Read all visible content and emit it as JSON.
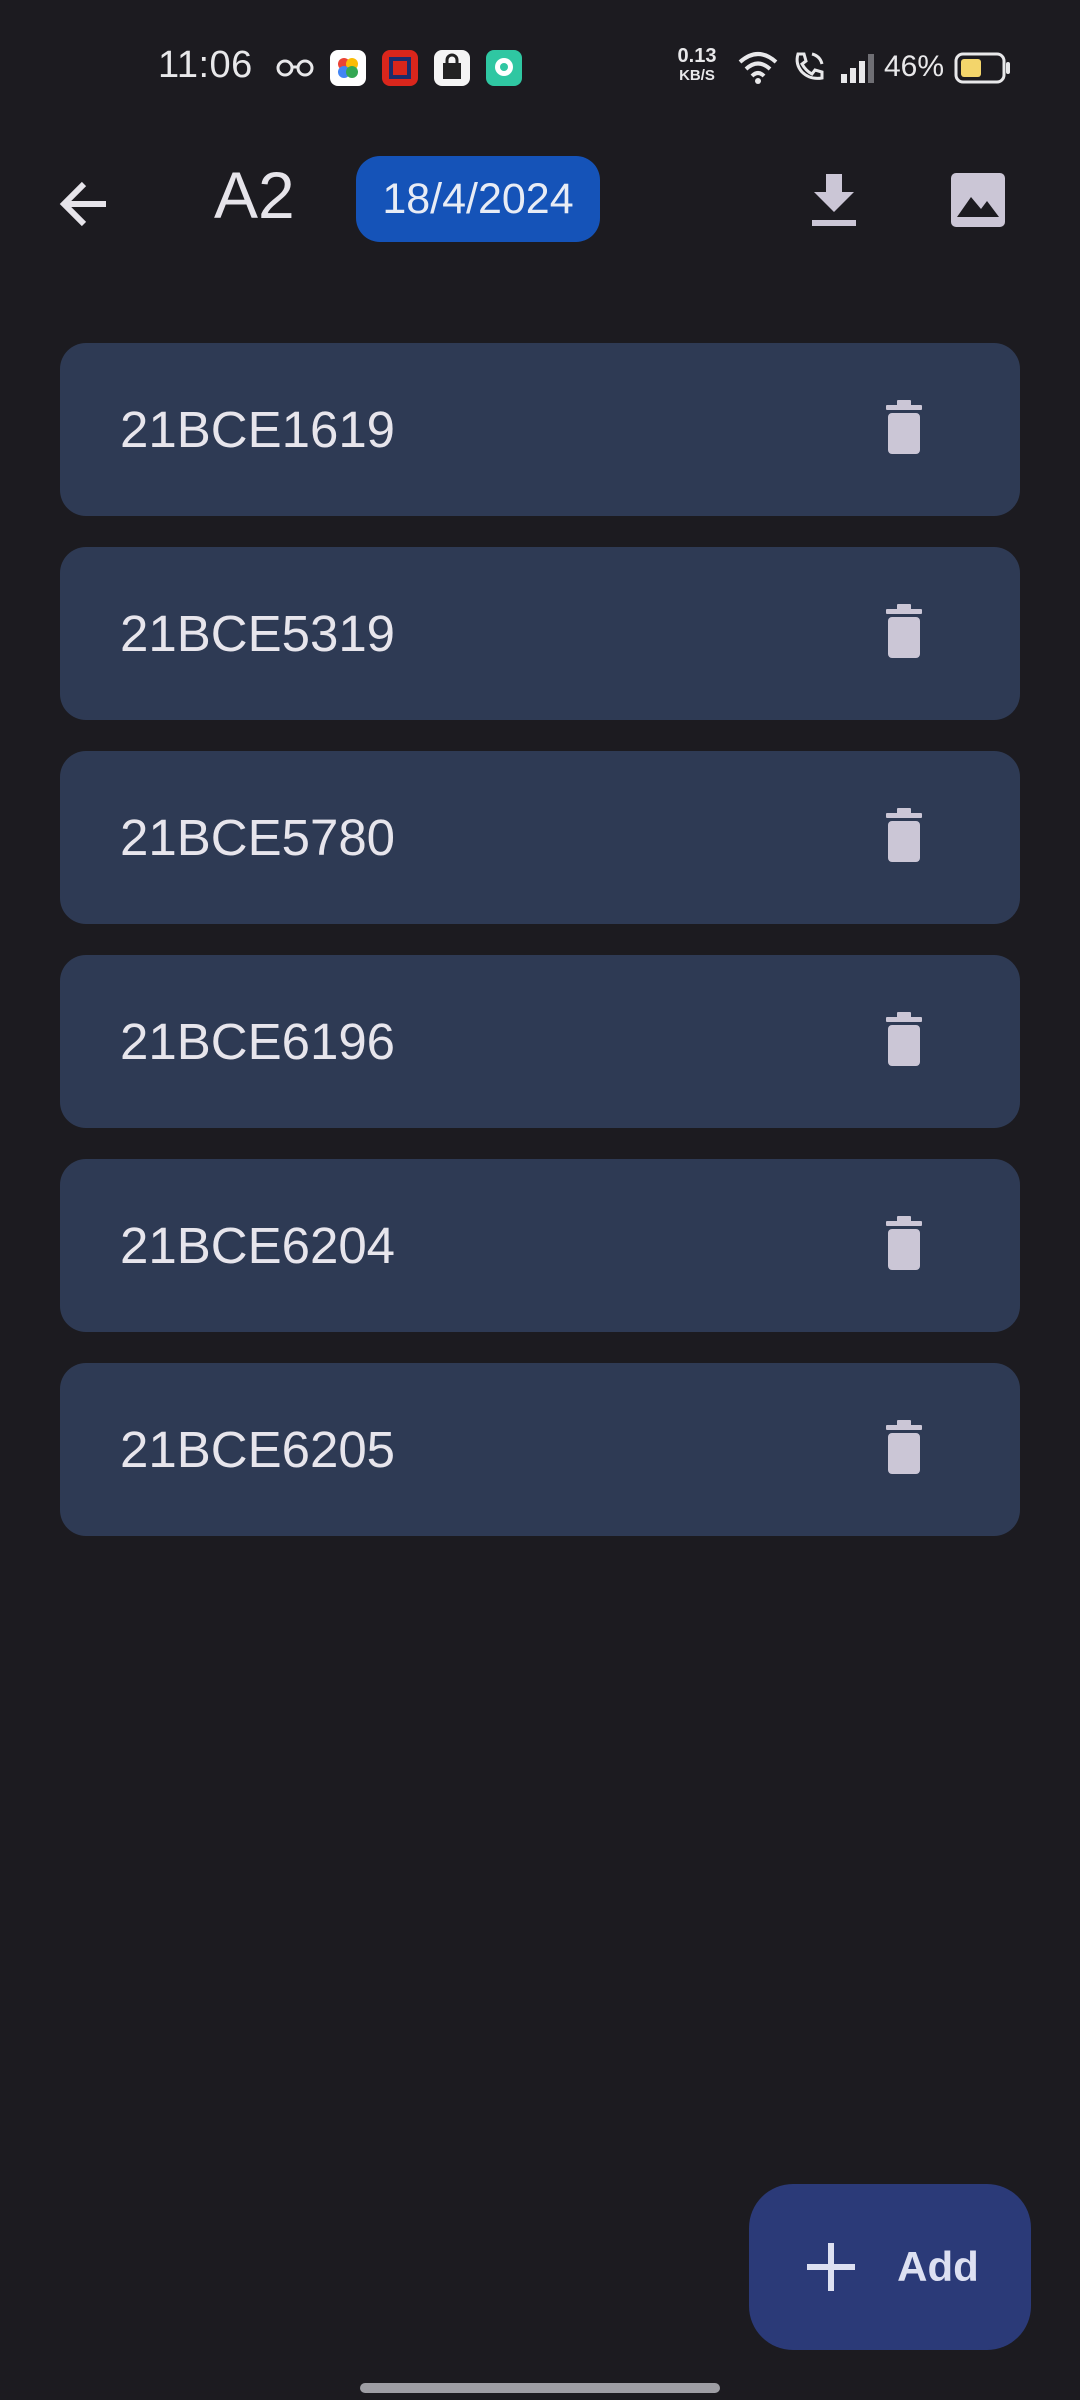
{
  "status_bar": {
    "time": "11:06",
    "net_speed_value": "0.13",
    "net_speed_unit": "KB/S",
    "battery_percent": "46%",
    "icons": [
      "incognito-icon",
      "photos-app-icon",
      "scanner-app-icon",
      "shopping-bag-icon",
      "chat-bubble-icon",
      "wifi-icon",
      "wifi-calling-icon",
      "cell-signal-icon",
      "battery-icon"
    ]
  },
  "app_bar": {
    "title": "A2",
    "date": "18/4/2024",
    "back_icon": "arrow-back-icon",
    "download_icon": "download-icon",
    "image_icon": "image-icon"
  },
  "list": {
    "items": [
      {
        "label": "21BCE1619"
      },
      {
        "label": "21BCE5319"
      },
      {
        "label": "21BCE5780"
      },
      {
        "label": "21BCE6196"
      },
      {
        "label": "21BCE6204"
      },
      {
        "label": "21BCE6205"
      }
    ],
    "delete_icon": "trash-icon"
  },
  "fab": {
    "label": "Add",
    "icon": "plus-icon"
  },
  "colors": {
    "background": "#1c1b20",
    "card": "#2e3a54",
    "date_chip": "#1553b8",
    "fab": "#2b3a78",
    "icon_tint": "#cbc6d6"
  }
}
